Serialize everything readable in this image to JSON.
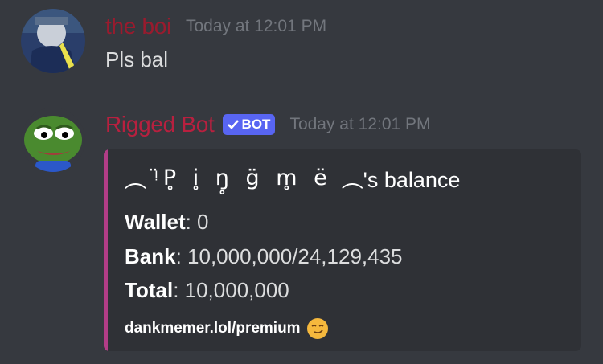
{
  "messages": [
    {
      "username": "the boi",
      "username_color": "#991b2e",
      "timestamp": "Today at 12:01 PM",
      "text": "Pls bal"
    },
    {
      "username": "Rigged Bot",
      "username_color": "#b8203f",
      "bot_tag": "BOT",
      "timestamp": "Today at 12:01 PM",
      "embed": {
        "accent_color": "#b23d87",
        "title_prefix": "︵",
        "title_name": "ᵎ̈P̥ i̥ ŋ̥ g̈ m̥ ë",
        "title_suffix": "︵'s balance",
        "wallet_label": "Wallet",
        "wallet_value": ": 0",
        "bank_label": "Bank",
        "bank_value": ": 10,000,000/24,129,435",
        "total_label": "Total",
        "total_value": ": 10,000,000",
        "footer": "dankmemer.lol/premium",
        "footer_emoji": "smirk-emoji"
      }
    }
  ]
}
